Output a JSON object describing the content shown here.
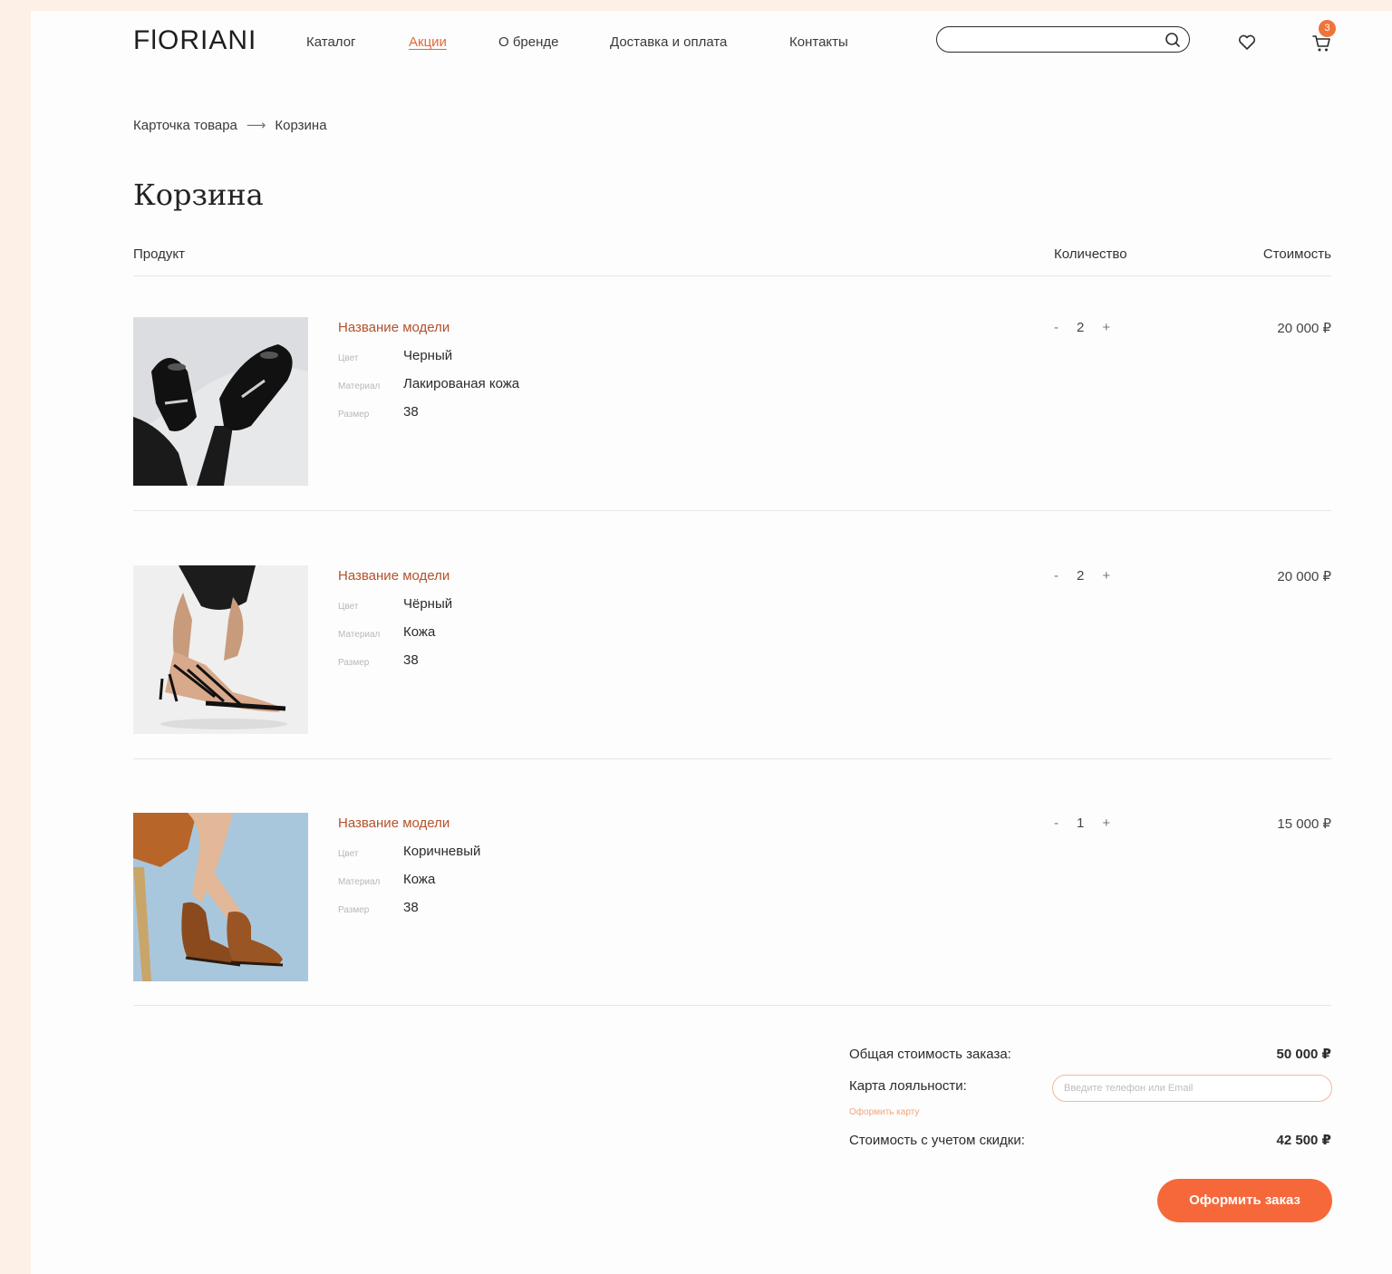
{
  "header": {
    "logo": "FlORIANI",
    "nav": [
      {
        "label": "Каталог",
        "active": false
      },
      {
        "label": "Акции",
        "active": true
      },
      {
        "label": "О бренде",
        "active": false
      },
      {
        "label": "Доставка и оплата",
        "active": false
      },
      {
        "label": "Контакты",
        "active": false
      }
    ],
    "search": {
      "value": "",
      "placeholder": ""
    },
    "cart_count": "3"
  },
  "breadcrumb": {
    "parent": "Карточка товара",
    "current": "Корзина"
  },
  "page_title": "Корзина",
  "table_header": {
    "product": "Продукт",
    "quantity": "Количество",
    "price": "Стоимость"
  },
  "attr_labels": {
    "color": "Цвет",
    "material": "Материал",
    "size": "Размер"
  },
  "items": [
    {
      "name": "Название модели",
      "color": "Черный",
      "material": "Лакированая кожа",
      "size": "38",
      "qty": "2",
      "price": "20 000 ₽",
      "image": "black-patent-loafers-photo"
    },
    {
      "name": "Название модели",
      "color": "Чёрный",
      "material": "Кожа",
      "size": "38",
      "qty": "2",
      "price": "20 000 ₽",
      "image": "black-strappy-sandals-photo"
    },
    {
      "name": "Название модели",
      "color": "Коричневый",
      "material": "Кожа",
      "size": "38",
      "qty": "1",
      "price": "15 000 ₽",
      "image": "brown-chelsea-boots-photo"
    }
  ],
  "summary": {
    "total_label": "Общая стоимость заказа:",
    "total_value": "50 000 ₽",
    "loyalty_label": "Карта лояльности:",
    "loyalty_placeholder": "Введите телефон или Email",
    "card_link": "Оформить карту",
    "discount_label": "Стоимость с учетом скидки:",
    "discount_value": "42 500 ₽",
    "order_button": "Оформить заказ"
  },
  "colors": {
    "accent": "#f6683a",
    "accent_text": "#b5512d",
    "background": "#fdf0e6"
  }
}
